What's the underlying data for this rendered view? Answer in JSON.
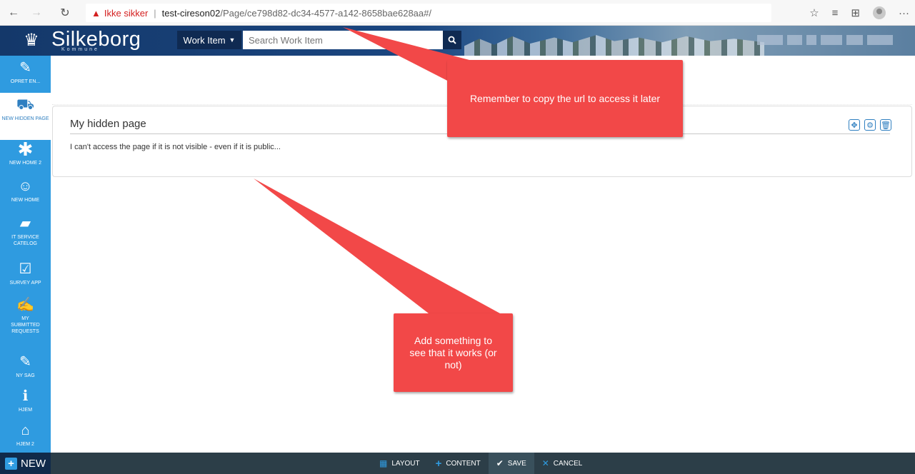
{
  "browser": {
    "back": "←",
    "forward": "→",
    "refresh": "↻",
    "not_secure": "Ikke sikker",
    "separator": "|",
    "url_host": "test-cireson02",
    "url_path": "/Page/ce798d82-dc34-4577-a142-8658bae628aa#/",
    "more": "···"
  },
  "header": {
    "logo": "Silkeborg",
    "logo_sub": "Kommune",
    "workitem_label": "Work Item",
    "search_placeholder": "Search Work Item"
  },
  "sidebar": {
    "items": [
      {
        "label": "OPRET EN...",
        "icon": "pencil-icon"
      },
      {
        "label": "NEW HIDDEN PAGE",
        "icon": "ambulance-icon"
      },
      {
        "label": "NEW HOME 2",
        "icon": "asterisk-icon"
      },
      {
        "label": "NEW HOME",
        "icon": "smile-icon"
      },
      {
        "label": "IT SERVICE CATELOG",
        "icon": "book-icon"
      },
      {
        "label": "SURVEY APP",
        "icon": "checkbox-icon"
      },
      {
        "label": "MY SUBMITTED REQUESTS",
        "icon": "edit-icon"
      },
      {
        "label": "NY SAG",
        "icon": "pencil-icon"
      },
      {
        "label": "HJEM",
        "icon": "info-icon"
      },
      {
        "label": "HJEM 2",
        "icon": "home-icon"
      }
    ]
  },
  "widget": {
    "title": "My hidden page",
    "text": "I can't access the page if it is not visible - even if it is public..."
  },
  "annotations": {
    "top": "Remember to copy the url to access it later",
    "bottom": "Add something to see that it works (or not)"
  },
  "bottom_bar": {
    "new": "NEW",
    "layout": "LAYOUT",
    "content": "CONTENT",
    "save": "SAVE",
    "cancel": "CANCEL"
  }
}
